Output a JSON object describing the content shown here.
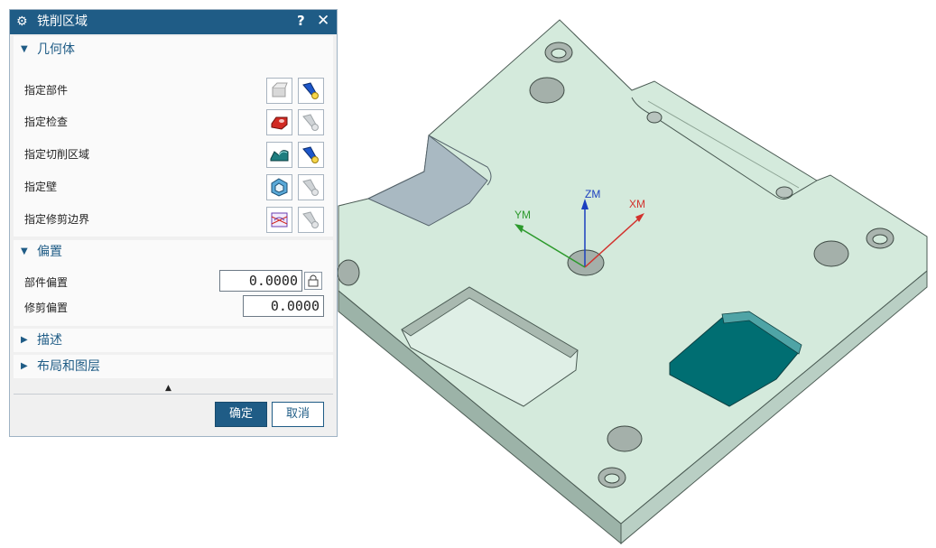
{
  "dialog": {
    "title": "铣削区域",
    "help_label": "?",
    "close_label": "✕",
    "groups": {
      "geometry": {
        "title": "几何体",
        "expanded": true,
        "rows": [
          {
            "label": "指定部件"
          },
          {
            "label": "指定检查"
          },
          {
            "label": "指定切削区域"
          },
          {
            "label": "指定壁"
          },
          {
            "label": "指定修剪边界"
          }
        ]
      },
      "offset": {
        "title": "偏置",
        "expanded": true,
        "part_offset_label": "部件偏置",
        "part_offset_value": "0.0000",
        "trim_offset_label": "修剪偏置",
        "trim_offset_value": "0.0000"
      },
      "description": {
        "title": "描述",
        "expanded": false
      },
      "layout": {
        "title": "布局和图层",
        "expanded": false
      }
    },
    "collapse_arrow": "▲",
    "ok_label": "确定",
    "cancel_label": "取消"
  },
  "viewport": {
    "axes": {
      "z": "ZM",
      "x": "XM",
      "y": "YM"
    }
  },
  "colors": {
    "accent": "#1f5c86",
    "part_face": "#d4eadc",
    "selected_face": "#006e72",
    "axis_z": "#1b3fbf",
    "axis_x": "#d2322d",
    "axis_y": "#2c9a2c"
  }
}
